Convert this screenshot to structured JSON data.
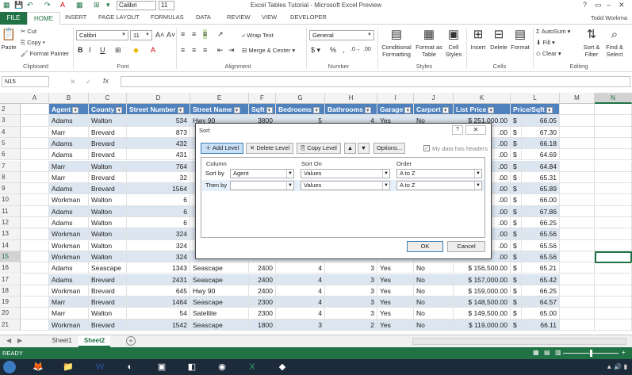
{
  "window": {
    "title": "Excel Tables Tutorial - Microsoft Excel Preview",
    "font_name": "Calibri",
    "font_size": "11",
    "user": "Todd Workma"
  },
  "ribbon_tabs": [
    "FILE",
    "HOME",
    "INSERT",
    "PAGE LAYOUT",
    "FORMULAS",
    "DATA",
    "REVIEW",
    "VIEW",
    "DEVELOPER"
  ],
  "ribbon": {
    "paste": "Paste",
    "cut": "Cut",
    "copy": "Copy",
    "format_painter": "Format Painter",
    "clipboard": "Clipboard",
    "font_name": "Calibri",
    "font_size": "11",
    "font": "Font",
    "wrap_text": "Wrap Text",
    "merge_center": "Merge & Center",
    "alignment": "Alignment",
    "number_format": "General",
    "number": "Number",
    "conditional_formatting": "Conditional Formatting",
    "format_as_table": "Format as Table",
    "cell_styles": "Cell Styles",
    "styles": "Styles",
    "insert": "Insert",
    "delete": "Delete",
    "format": "Format",
    "cells": "Cells",
    "autosum": "AutoSum",
    "fill": "Fill",
    "clear": "Clear",
    "sort_filter": "Sort & Filter",
    "find_select": "Find & Select",
    "editing": "Editing"
  },
  "formula_bar": {
    "name_box": "N15",
    "fx": "fx",
    "value": ""
  },
  "columns": [
    "A",
    "B",
    "C",
    "D",
    "E",
    "F",
    "G",
    "H",
    "I",
    "J",
    "K",
    "L",
    "M",
    "N"
  ],
  "table_headers": [
    "Agent",
    "County",
    "Street Number",
    "Street Name",
    "Sqft",
    "Bedrooms",
    "Bathrooms",
    "Garage",
    "Carport",
    "List Price",
    "Price/Sqft"
  ],
  "rows": [
    {
      "n": "3",
      "c": [
        "Adams",
        "Walton",
        "534",
        "Hwy 90",
        "3800",
        "5",
        "4",
        "Yes",
        "No",
        "$ 251,000.00",
        "$",
        "66.05"
      ]
    },
    {
      "n": "4",
      "c": [
        "Marr",
        "Brevard",
        "873",
        "",
        "",
        "",
        "",
        "",
        "",
        ".00",
        "$",
        "67.30"
      ]
    },
    {
      "n": "5",
      "c": [
        "Adams",
        "Brevard",
        "432",
        "",
        "",
        "",
        "",
        "",
        "",
        ".00",
        "$",
        "66.18"
      ]
    },
    {
      "n": "6",
      "c": [
        "Adams",
        "Brevard",
        "431",
        "",
        "",
        "",
        "",
        "",
        "",
        ".00",
        "$",
        "64.69"
      ]
    },
    {
      "n": "7",
      "c": [
        "Marr",
        "Walton",
        "764",
        "",
        "",
        "",
        "",
        "",
        "",
        ".00",
        "$",
        "64.84"
      ]
    },
    {
      "n": "8",
      "c": [
        "Marr",
        "Brevard",
        "32",
        "",
        "",
        "",
        "",
        "",
        "",
        ".00",
        "$",
        "65.31"
      ]
    },
    {
      "n": "9",
      "c": [
        "Adams",
        "Brevard",
        "1564",
        "",
        "",
        "",
        "",
        "",
        "",
        ".00",
        "$",
        "65.89"
      ]
    },
    {
      "n": "10",
      "c": [
        "Workman",
        "Walton",
        "6",
        "",
        "",
        "",
        "",
        "",
        "",
        ".00",
        "$",
        "66.00"
      ]
    },
    {
      "n": "11",
      "c": [
        "Adams",
        "Walton",
        "6",
        "",
        "",
        "",
        "",
        "",
        "",
        ".00",
        "$",
        "67.86"
      ]
    },
    {
      "n": "12",
      "c": [
        "Adams",
        "Walton",
        "6",
        "",
        "",
        "",
        "",
        "",
        "",
        ".00",
        "$",
        "66.25"
      ]
    },
    {
      "n": "13",
      "c": [
        "Workman",
        "Walton",
        "324",
        "",
        "",
        "",
        "",
        "",
        "",
        ".00",
        "$",
        "65.56"
      ]
    },
    {
      "n": "14",
      "c": [
        "Workman",
        "Walton",
        "324",
        "",
        "",
        "",
        "",
        "",
        "",
        ".00",
        "$",
        "65.56"
      ]
    },
    {
      "n": "15",
      "c": [
        "Workman",
        "Walton",
        "324",
        "",
        "",
        "",
        "",
        "",
        "",
        ".00",
        "$",
        "65.56"
      ]
    },
    {
      "n": "16",
      "c": [
        "Adams",
        "Seascape",
        "1343",
        "Seascape",
        "2400",
        "4",
        "3",
        "Yes",
        "No",
        "$ 156,500.00",
        "$",
        "65.21"
      ]
    },
    {
      "n": "17",
      "c": [
        "Adams",
        "Brevard",
        "2431",
        "Seascape",
        "2400",
        "4",
        "3",
        "Yes",
        "No",
        "$ 157,000.00",
        "$",
        "65.42"
      ]
    },
    {
      "n": "18",
      "c": [
        "Workman",
        "Brevard",
        "645",
        "Hwy 90",
        "2400",
        "4",
        "3",
        "Yes",
        "No",
        "$ 159,000.00",
        "$",
        "66.25"
      ]
    },
    {
      "n": "19",
      "c": [
        "Marr",
        "Brevard",
        "1464",
        "Seascape",
        "2300",
        "4",
        "3",
        "Yes",
        "No",
        "$ 148,500.00",
        "$",
        "64.57"
      ]
    },
    {
      "n": "20",
      "c": [
        "Marr",
        "Walton",
        "54",
        "Satellite",
        "2300",
        "4",
        "3",
        "Yes",
        "No",
        "$ 149,500.00",
        "$",
        "65.00"
      ]
    },
    {
      "n": "21",
      "c": [
        "Workman",
        "Brevard",
        "1542",
        "Seascape",
        "1800",
        "3",
        "2",
        "Yes",
        "No",
        "$ 119,000.00",
        "$",
        "66.11"
      ]
    }
  ],
  "sort_dialog": {
    "title": "Sort",
    "help": "?",
    "close": "✕",
    "add_level": "Add Level",
    "delete_level": "Delete Level",
    "copy_level": "Copy Level",
    "options": "Options...",
    "headers_label": "My data has headers",
    "col_header": "Column",
    "sort_on_header": "Sort On",
    "order_header": "Order",
    "sort_by": "Sort by",
    "then_by": "Then by",
    "sort_by_column": "Agent",
    "sort_by_on": "Values",
    "sort_by_order": "A to Z",
    "then_by_column": "",
    "then_by_on": "Values",
    "then_by_order": "A to Z",
    "ok": "OK",
    "cancel": "Cancel"
  },
  "sheets": [
    "Sheet1",
    "Sheet2"
  ],
  "status": {
    "text": "READY"
  },
  "colors": {
    "excel_green": "#217346",
    "table_header": "#4f81bd",
    "table_band": "#dce6f1"
  }
}
